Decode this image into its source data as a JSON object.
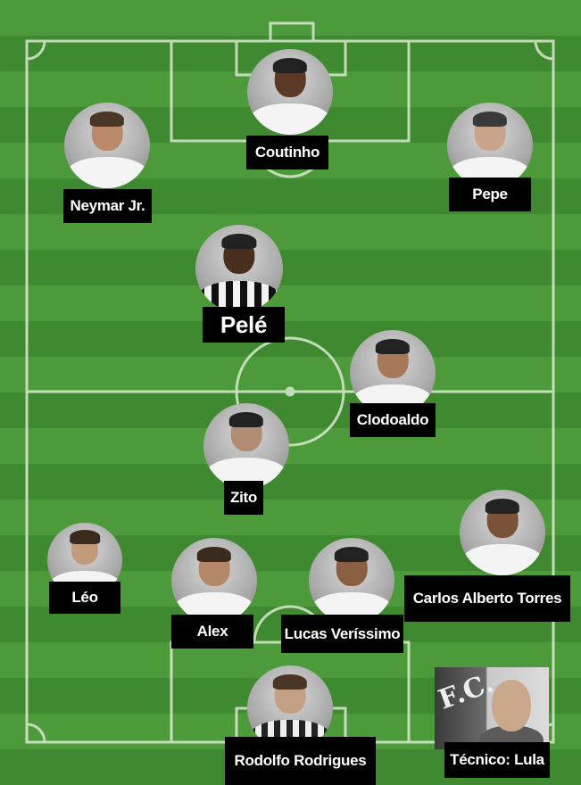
{
  "players": [
    {
      "id": "coutinho",
      "name": "Coutinho",
      "shirt": "white",
      "skin": "#5a3a24"
    },
    {
      "id": "neymar",
      "name": "Neymar Jr.",
      "shirt": "white",
      "skin": "#b9896a"
    },
    {
      "id": "pepe",
      "name": "Pepe",
      "shirt": "white",
      "skin": "#c9a38a"
    },
    {
      "id": "pele",
      "name": "Pelé",
      "shirt": "striped",
      "skin": "#4a2f1e"
    },
    {
      "id": "clodoaldo",
      "name": "Clodoaldo",
      "shirt": "white",
      "skin": "#a8785a"
    },
    {
      "id": "zito",
      "name": "Zito",
      "shirt": "white",
      "skin": "#b08c72"
    },
    {
      "id": "leo",
      "name": "Léo",
      "shirt": "white",
      "skin": "#c49a7c"
    },
    {
      "id": "alex",
      "name": "Alex",
      "shirt": "white",
      "skin": "#b48866"
    },
    {
      "id": "lucas",
      "name": "Lucas Veríssimo",
      "shirt": "white",
      "skin": "#8a5e40"
    },
    {
      "id": "carlos",
      "name": "Carlos Alberto Torres",
      "shirt": "white",
      "skin": "#7a5238"
    },
    {
      "id": "rodolfo",
      "name": "Rodolfo Rodrigues",
      "shirt": "striped",
      "skin": "#c4a084"
    }
  ],
  "coach": {
    "label": "Técnico:  Lula",
    "crest_text": "F.C."
  },
  "colors": {
    "pitch_light": "#4c9a3a",
    "pitch_dark": "#3f8a30",
    "line": "#d8ead0",
    "label_bg": "#000000",
    "label_text": "#ffffff"
  }
}
